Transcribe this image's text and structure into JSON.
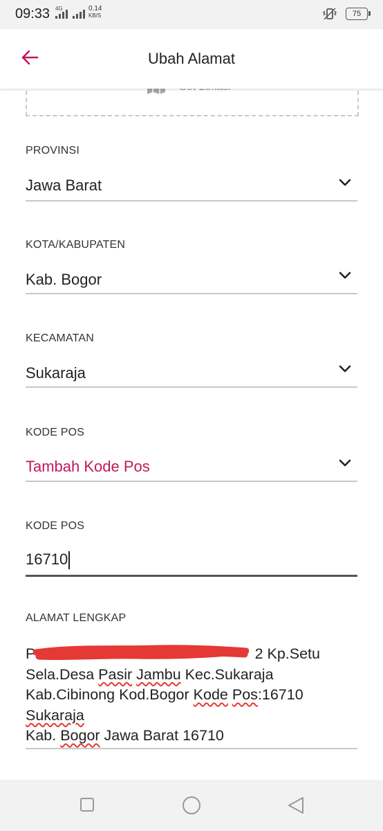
{
  "status_bar": {
    "time": "09:33",
    "network_type": "4G",
    "speed_value": "0.14",
    "speed_unit": "KB/S",
    "battery": "75"
  },
  "app_bar": {
    "title": "Ubah Alamat",
    "back_icon": "arrow-left-icon",
    "accent_color": "#c2185b"
  },
  "map": {
    "label": "Set Lokasi",
    "icon": "map-icon"
  },
  "form": {
    "provinsi": {
      "label": "PROVINSI",
      "value": "Jawa Barat"
    },
    "kota": {
      "label": "KOTA/KABUPATEN",
      "value": "Kab. Bogor"
    },
    "kecamatan": {
      "label": "KECAMATAN",
      "value": "Sukaraja"
    },
    "kode_pos_select": {
      "label": "KODE POS",
      "value": "Tambah Kode Pos"
    },
    "kode_pos_input": {
      "label": "KODE POS",
      "value": "16710"
    },
    "alamat": {
      "label": "ALAMAT LENGKAP",
      "line1_visible_start": "P",
      "line1_visible_end": "2 Kp.Setu",
      "line2_a": "Sela.Desa ",
      "line2_b": "Pasir",
      "line2_c": " ",
      "line2_d": "Jambu",
      "line2_e": " Kec.Sukaraja",
      "line3_a": "Kab.Cibinong Kod.Bogor ",
      "line3_b": "Kode",
      "line3_c": " ",
      "line3_d": "Pos",
      "line3_e": ":16710",
      "line4": "Sukaraja",
      "line5_a": "Kab. ",
      "line5_b": "Bogor",
      "line5_c": " Jawa Barat 16710"
    }
  },
  "nav_bar": {
    "recent_icon": "square-icon",
    "home_icon": "circle-icon",
    "back_icon": "triangle-back-icon"
  }
}
